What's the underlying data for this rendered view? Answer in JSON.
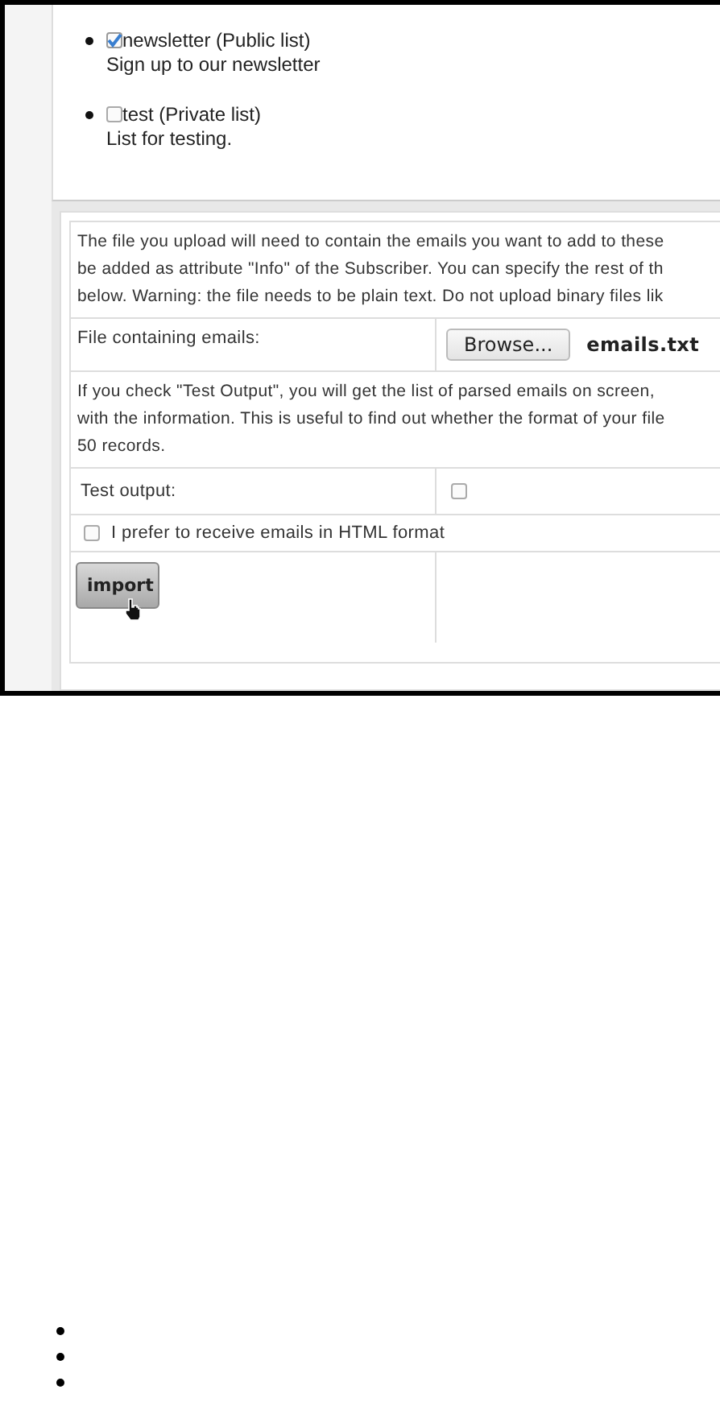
{
  "lists": [
    {
      "name": "newsletter (Public list)",
      "description": "Sign up to our newsletter",
      "checked": true
    },
    {
      "name": "test (Private list)",
      "description": "List for testing.",
      "checked": false
    }
  ],
  "intro_lines": [
    "The file you upload will need to contain the emails you want to add to these",
    "be added as attribute \"Info\" of the Subscriber. You can specify the rest of th",
    "below. Warning: the file needs to be plain text. Do not upload binary files lik"
  ],
  "file_field": {
    "label": "File containing emails:",
    "button": "Browse...",
    "filename": "emails.txt"
  },
  "test_lines": [
    "If you check \"Test Output\", you will get the list of parsed emails on screen,",
    "with the information. This is useful to find out whether the format of your file",
    "50 records."
  ],
  "test_output": {
    "label": "Test output:",
    "checked": false
  },
  "html_pref": {
    "label": "I prefer to receive emails in HTML format",
    "checked": false
  },
  "import_button": "import",
  "bottom_list": [
    {
      "kind": "empty_item"
    },
    {
      "kind": "empty_item"
    },
    {
      "kind": "empty_item"
    }
  ]
}
